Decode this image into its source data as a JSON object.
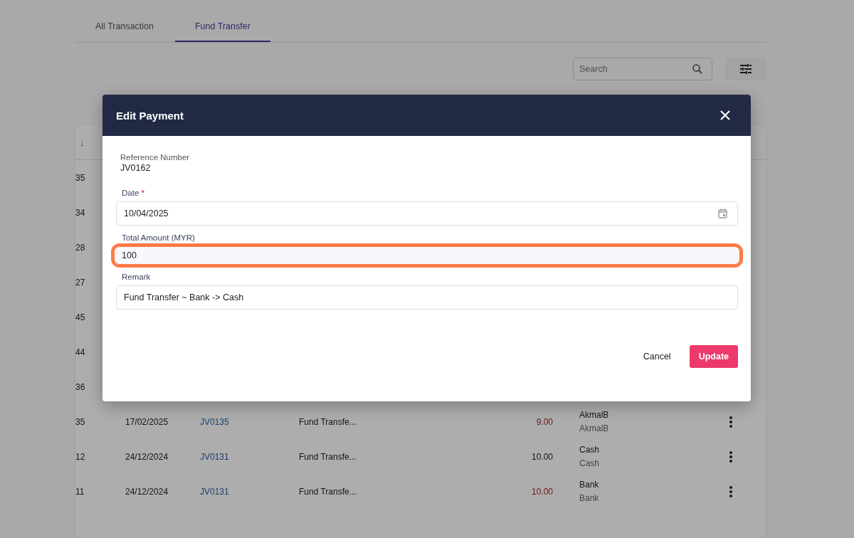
{
  "tabs": [
    {
      "label": "All Transaction",
      "selected": false
    },
    {
      "label": "Fund Transfer",
      "selected": true
    }
  ],
  "search": {
    "placeholder": "Search"
  },
  "table": {
    "header_sort": "↓",
    "rows": [
      {
        "column_1": "35"
      },
      {
        "column_1": "34"
      },
      {
        "column_1": "28"
      },
      {
        "column_1": "27"
      },
      {
        "column_1": "45"
      },
      {
        "column_1": "44"
      },
      {
        "column_1": "36"
      },
      {
        "column_1": "35",
        "date": "17/02/2025",
        "reference": "JV0135",
        "description": "Fund Transfe...",
        "amount": "9.00",
        "kind": "debit",
        "account": "AkmalB",
        "account_sub": "AkmalB"
      },
      {
        "column_1": "12",
        "date": "24/12/2024",
        "reference": "JV0131",
        "description": "Fund Transfe...",
        "amount": "10.00",
        "kind": "credit",
        "account": "Cash",
        "account_sub": "Cash"
      },
      {
        "column_1": "11",
        "date": "24/12/2024",
        "reference": "JV0131",
        "description": "Fund Transfe...",
        "amount": "10.00",
        "kind": "debit",
        "account": "Bank",
        "account_sub": "Bank"
      }
    ]
  },
  "dialog": {
    "title": "Edit Payment",
    "reference_label": "Reference Number",
    "reference_value": "JV0162",
    "fields": [
      {
        "label": "Date",
        "required_mark": "*",
        "value": "10/04/2025",
        "kind": "date",
        "highlighted": false
      },
      {
        "label": "Total Amount (MYR)",
        "value": "100",
        "kind": "text",
        "highlighted": true
      },
      {
        "label": "Remark",
        "value": "Fund Transfer ~ Bank -> Cash",
        "kind": "text",
        "highlighted": false
      }
    ],
    "buttons": [
      {
        "label": "Cancel",
        "kind": "text"
      },
      {
        "label": "Update",
        "kind": "primary"
      }
    ]
  }
}
